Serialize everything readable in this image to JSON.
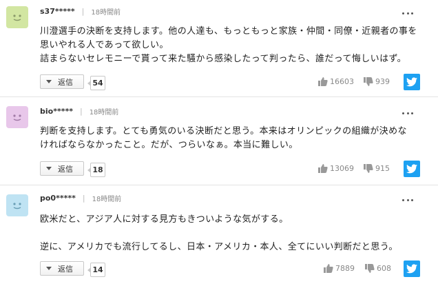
{
  "reply_label": "返信",
  "colors": {
    "twitter": "#1da1f2",
    "avatar_green": "#d2e6a2",
    "avatar_pink": "#e8c7ea",
    "avatar_blue": "#bfe3f3"
  },
  "icons": {
    "more": "more-icon",
    "reply_caret": "caret-down-icon",
    "like": "thumbs-up-icon",
    "dislike": "thumbs-down-icon",
    "share": "twitter-icon"
  },
  "comments": [
    {
      "user": "s37*****",
      "time": "18時間前",
      "lines": [
        "川澄選手の決断を支持します。他の人達も、もっともっと家族・仲間・同僚・近親者の事を",
        "思いやれる人であって欲しい。",
        "詰まらないセレモニーで貰って来た騒から感染したって判ったら、誰だって悔しいはず。"
      ],
      "replies": "54",
      "likes": "16603",
      "dislikes": "939"
    },
    {
      "user": "bio*****",
      "time": "18時間前",
      "lines": [
        "判断を支持します。とても勇気のいる決断だと思う。本来はオリンピックの組織が決めな",
        "ければならなかったこと。だが、つらいなぁ。本当に難しい。"
      ],
      "replies": "18",
      "likes": "13069",
      "dislikes": "915"
    },
    {
      "user": "po0*****",
      "time": "18時間前",
      "lines": [
        "欧米だと、アジア人に対する見方もきついような気がする。",
        "",
        "逆に、アメリカでも流行してるし、日本・アメリカ・本人、全てにいい判断だと思う。"
      ],
      "replies": "14",
      "likes": "7889",
      "dislikes": "608"
    }
  ]
}
